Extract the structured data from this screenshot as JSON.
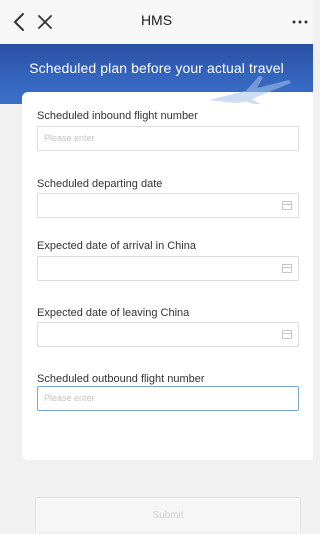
{
  "navbar": {
    "title": "HMS",
    "back_icon": "chevron-left-icon",
    "close_icon": "close-icon",
    "more_icon": "more-horizontal-icon"
  },
  "banner": {
    "text": "Scheduled plan before your actual travel"
  },
  "form": {
    "fields": [
      {
        "label": "Scheduled inbound flight number",
        "placeholder": "Please enter",
        "type": "text"
      },
      {
        "label": "Scheduled departing date",
        "placeholder": "",
        "type": "date",
        "icon": "calendar-icon"
      },
      {
        "label": "Expected date of arrival in China",
        "placeholder": "",
        "type": "date",
        "icon": "calendar-icon"
      },
      {
        "label": "Expected date of leaving China",
        "placeholder": "",
        "type": "date",
        "icon": "calendar-icon"
      },
      {
        "label": "Scheduled outbound flight number",
        "placeholder": "Please enter",
        "type": "text",
        "focused": true
      }
    ]
  },
  "submit": {
    "label": "Submit"
  },
  "colors": {
    "banner": "#3565bd",
    "focus_border": "#7aa4d6",
    "placeholder": "#c4c4c4"
  }
}
